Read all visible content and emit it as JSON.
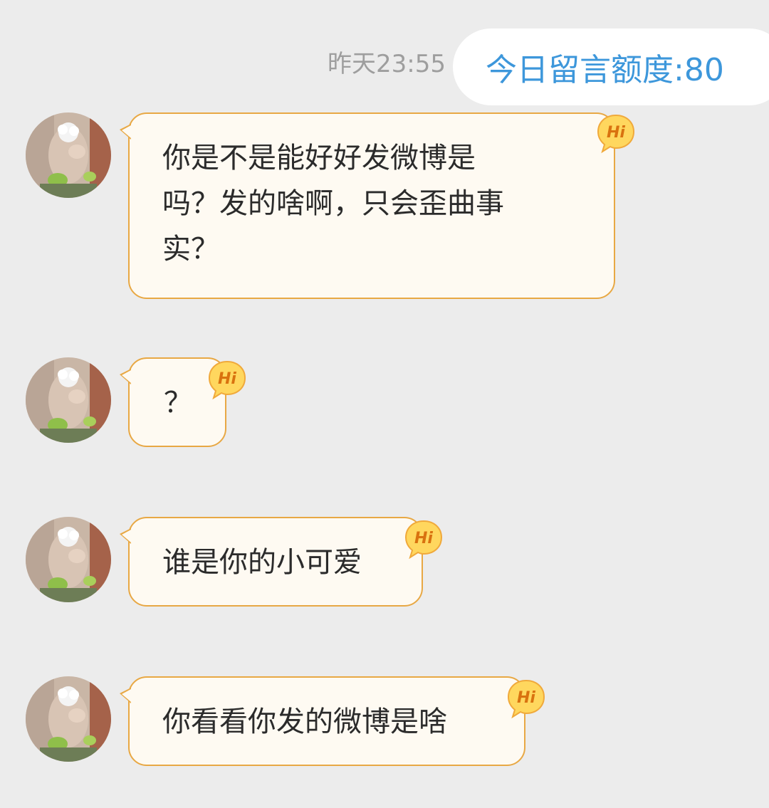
{
  "header": {
    "timestamp": "昨天23:55",
    "quota_label": "今日留言额度:80"
  },
  "messages": [
    {
      "text": "你是不是能好好发微博是\n吗？发的啥啊，只会歪曲事\n实？",
      "badge": "Hi"
    },
    {
      "text": "？",
      "badge": "Hi"
    },
    {
      "text": "谁是你的小可爱",
      "badge": "Hi"
    },
    {
      "text": "你看看你发的微博是啥",
      "badge": "Hi"
    }
  ],
  "colors": {
    "background": "#ececec",
    "bubble_fill": "#fefaf2",
    "bubble_border": "#e8a844",
    "quota_text": "#3d97db",
    "badge_fill": "#ffd75e",
    "badge_text": "#d9720f"
  }
}
